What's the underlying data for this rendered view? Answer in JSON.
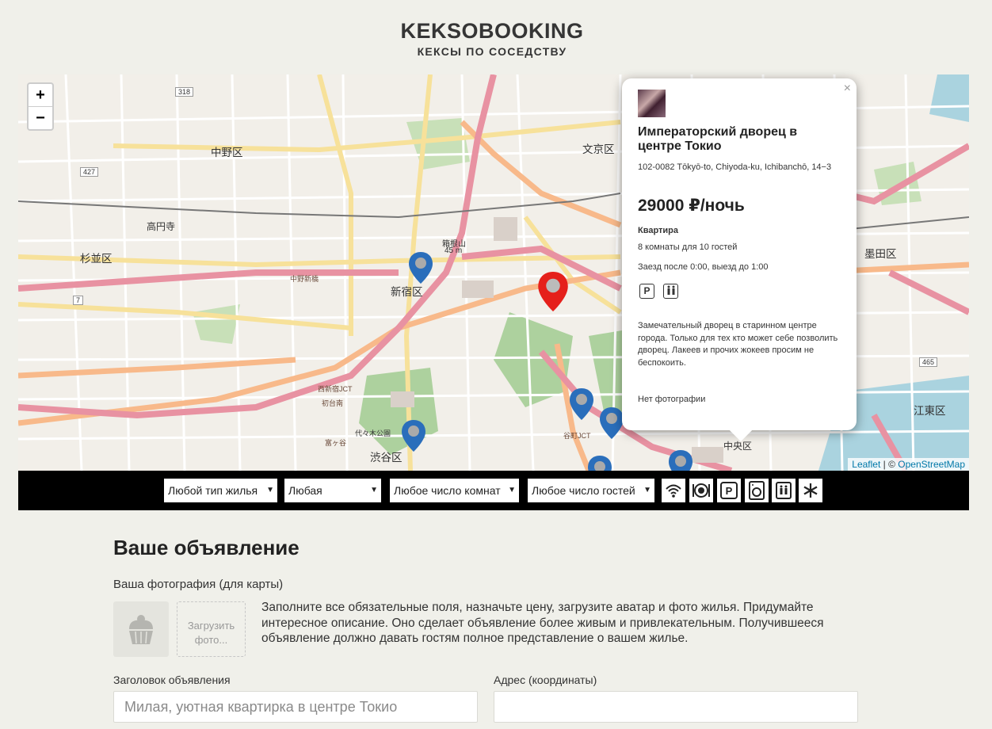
{
  "header": {
    "logo_name": "KEKSOBOOKING",
    "logo_tagline": "КЕКСЫ ПО СОСЕДСТВУ"
  },
  "map": {
    "zoom_in": "+",
    "zoom_out": "−",
    "attribution_leaflet": "Leaflet",
    "attribution_sep": " | © ",
    "attribution_osm": "OpenStreetMap",
    "labels": [
      "中野区",
      "杉並区",
      "新宿区",
      "渋谷区",
      "文京区",
      "墨田区",
      "江東区",
      "中央区",
      "高円寺",
      "箱根山",
      "45 m",
      "中野新橋",
      "西新宿JCT",
      "初台南",
      "富ヶ谷",
      "代々木公園",
      "谷町JCT"
    ],
    "road_numbers": [
      "318",
      "427",
      "7",
      "465"
    ],
    "pin_colors": {
      "main": "#e5201b",
      "similar": "#2a6ebb"
    }
  },
  "popup": {
    "title": "Императорский дворец в центре Токио",
    "address": "102-0082 Tōkyō-to, Chiyoda-ku, Ichibanchō, 14−3",
    "price": "29000 ₽/ночь",
    "type": "Квартира",
    "capacity": "8 комнаты для 10 гостей",
    "time": "Заезд после 0:00, выезд до 1:00",
    "features": [
      "parking-icon",
      "washer-icon"
    ],
    "description": "Замечательный дворец в старинном центре города. Только для тех кто может себе позволить дворец. Лакеев и прочих жокеев просим не беспокоить.",
    "photos_text": "Нет фотографии",
    "close": "×"
  },
  "filters": {
    "type": "Любой тип жилья",
    "price": "Любая",
    "rooms": "Любое число комнат",
    "guests": "Любое число гостей",
    "features": [
      "wifi-icon",
      "dishwasher-icon",
      "parking-icon",
      "washer-icon",
      "elevator-icon",
      "conditioner-icon"
    ]
  },
  "form": {
    "heading": "Ваше объявление",
    "photo_label": "Ваша фотография (для карты)",
    "upload_text": "Загрузить фото...",
    "hint": "Заполните все обязательные поля, назначьте цену, загрузите аватар и фото жилья. Придумайте интересное описание. Оно сделает объявление более живым и привлекательным. Получившееся объявление должно давать гостям полное представление о вашем жилье.",
    "title_label": "Заголовок объявления",
    "title_placeholder": "Милая, уютная квартирка в центре Токио",
    "address_label": "Адрес (координаты)",
    "address_value": ""
  }
}
